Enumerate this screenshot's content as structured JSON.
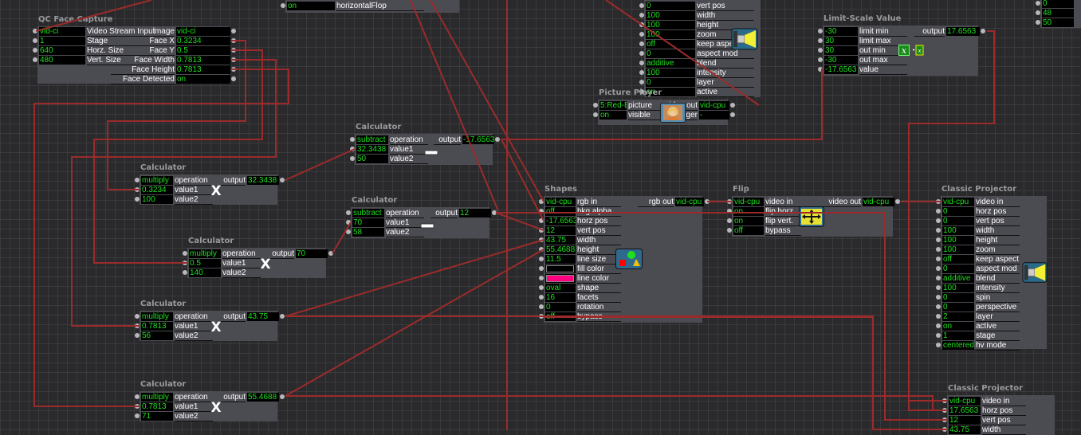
{
  "colors": {
    "wire": "#9b2b2b",
    "value_text": "#1ee11e",
    "node_body": "#4b4b52",
    "node_title": "#9a9a9e"
  },
  "nodes": [
    {
      "title": "",
      "inputs": [
        {
          "value": "on",
          "label": "horizontalFlop"
        }
      ],
      "outputs": [],
      "icon": ""
    },
    {
      "title": "QC Face Capture",
      "inputs": [
        {
          "value": "vid-ci",
          "label": "Video Stream Input"
        },
        {
          "value": "1",
          "label": "Stage"
        },
        {
          "value": "640",
          "label": "Horz. Size"
        },
        {
          "value": "480",
          "label": "Vert. Size"
        }
      ],
      "outputs": [
        {
          "label": "image",
          "value": "vid-ci"
        },
        {
          "label": "Face X",
          "value": "0.3234"
        },
        {
          "label": "Face Y",
          "value": "0.5"
        },
        {
          "label": "Face Width",
          "value": "0.7813"
        },
        {
          "label": "Face Height",
          "value": "0.7813"
        },
        {
          "label": "Face Detected",
          "value": "on"
        }
      ],
      "icon": ""
    },
    {
      "title": "",
      "inputs": [
        {
          "value": "0",
          "label": "vert pos"
        },
        {
          "value": "100",
          "label": "width"
        },
        {
          "value": "100",
          "label": "height"
        },
        {
          "value": "100",
          "label": "zoom"
        },
        {
          "value": "off",
          "label": "keep aspect"
        },
        {
          "value": "0",
          "label": "aspect mod"
        },
        {
          "value": "additive",
          "label": "blend"
        },
        {
          "value": "100",
          "label": "intensity"
        },
        {
          "value": "0",
          "label": "layer"
        },
        {
          "value": "on",
          "label": "active"
        }
      ],
      "outputs": [],
      "icon": "projector-icon"
    },
    {
      "title": "Picture Player",
      "inputs": [
        {
          "value": "5:Red-B",
          "label": "picture"
        },
        {
          "value": "on",
          "label": "visible"
        }
      ],
      "outputs": [
        {
          "label": "video out",
          "value": "vid-cpu"
        },
        {
          "label": "trigger",
          "value": "-"
        }
      ],
      "icon": "picture-icon"
    },
    {
      "title": "Limit-Scale Value",
      "inputs": [
        {
          "value": "-30",
          "label": "limit min"
        },
        {
          "value": "30",
          "label": "limit max"
        },
        {
          "value": "30",
          "label": "out min"
        },
        {
          "value": "-30",
          "label": "out max"
        },
        {
          "value": "-17.6563",
          "label": "value"
        }
      ],
      "outputs": [
        {
          "label": "output",
          "value": "17.6563"
        }
      ],
      "icon": "formula-icon"
    },
    {
      "title": "",
      "inputs": [
        {
          "value": "0",
          "label": ""
        },
        {
          "value": "48",
          "label": ""
        },
        {
          "value": "50",
          "label": ""
        }
      ],
      "outputs": [],
      "icon": ""
    },
    {
      "title": "Calculator",
      "inputs": [
        {
          "value": "subtract",
          "label": "operation"
        },
        {
          "value": "32.3438",
          "label": "value1"
        },
        {
          "value": "50",
          "label": "value2"
        }
      ],
      "outputs": [
        {
          "label": "output",
          "value": "-17.6563"
        }
      ],
      "icon": "minus-icon"
    },
    {
      "title": "Calculator",
      "inputs": [
        {
          "value": "multiply",
          "label": "operation"
        },
        {
          "value": "0.3234",
          "label": "value1"
        },
        {
          "value": "100",
          "label": "value2"
        }
      ],
      "outputs": [
        {
          "label": "output",
          "value": "32.3438"
        }
      ],
      "icon": "multiply-icon"
    },
    {
      "title": "Calculator",
      "inputs": [
        {
          "value": "subtract",
          "label": "operation"
        },
        {
          "value": "70",
          "label": "value1"
        },
        {
          "value": "58",
          "label": "value2"
        }
      ],
      "outputs": [
        {
          "label": "output",
          "value": "12"
        }
      ],
      "icon": "minus-icon"
    },
    {
      "title": "Calculator",
      "inputs": [
        {
          "value": "multiply",
          "label": "operation"
        },
        {
          "value": "0.5",
          "label": "value1"
        },
        {
          "value": "140",
          "label": "value2"
        }
      ],
      "outputs": [
        {
          "label": "output",
          "value": "70"
        }
      ],
      "icon": "multiply-icon"
    },
    {
      "title": "Calculator",
      "inputs": [
        {
          "value": "multiply",
          "label": "operation"
        },
        {
          "value": "0.7813",
          "label": "value1"
        },
        {
          "value": "56",
          "label": "value2"
        }
      ],
      "outputs": [
        {
          "label": "output",
          "value": "43.75"
        }
      ],
      "icon": "multiply-icon"
    },
    {
      "title": "Calculator",
      "inputs": [
        {
          "value": "multiply",
          "label": "operation"
        },
        {
          "value": "0.7813",
          "label": "value1"
        },
        {
          "value": "71",
          "label": "value2"
        }
      ],
      "outputs": [
        {
          "label": "output",
          "value": "55.4688"
        }
      ],
      "icon": "multiply-icon"
    },
    {
      "title": "Shapes",
      "inputs": [
        {
          "value": "vid-cpu",
          "label": "rgb in"
        },
        {
          "value": "off",
          "label": "bkg alpha"
        },
        {
          "value": "-17.6563",
          "label": "horz pos"
        },
        {
          "value": "12",
          "label": "vert pos"
        },
        {
          "value": "43.75",
          "label": "width"
        },
        {
          "value": "55.4688",
          "label": "height"
        },
        {
          "value": "11.5",
          "label": "line size"
        },
        {
          "value": "",
          "label": "fill color",
          "swatch": "#000000"
        },
        {
          "value": "",
          "label": "line color",
          "swatch": "#ff0080"
        },
        {
          "value": "oval",
          "label": "shape"
        },
        {
          "value": "16",
          "label": "facets"
        },
        {
          "value": "0",
          "label": "rotation"
        },
        {
          "value": "off",
          "label": "bypass"
        }
      ],
      "outputs": [
        {
          "label": "rgb out",
          "value": "vid-cpu"
        }
      ],
      "icon": "shapes-icon"
    },
    {
      "title": "Flip",
      "inputs": [
        {
          "value": "vid-cpu",
          "label": "video in"
        },
        {
          "value": "on",
          "label": "flip horz."
        },
        {
          "value": "on",
          "label": "flip vert."
        },
        {
          "value": "off",
          "label": "bypass"
        }
      ],
      "outputs": [
        {
          "label": "video out",
          "value": "vid-cpu"
        }
      ],
      "icon": "flip-icon"
    },
    {
      "title": "Classic Projector",
      "inputs": [
        {
          "value": "vid-cpu",
          "label": "video in"
        },
        {
          "value": "0",
          "label": "horz pos"
        },
        {
          "value": "0",
          "label": "vert pos"
        },
        {
          "value": "100",
          "label": "width"
        },
        {
          "value": "100",
          "label": "height"
        },
        {
          "value": "100",
          "label": "zoom"
        },
        {
          "value": "off",
          "label": "keep aspect"
        },
        {
          "value": "0",
          "label": "aspect mod"
        },
        {
          "value": "additive",
          "label": "blend"
        },
        {
          "value": "100",
          "label": "intensity"
        },
        {
          "value": "0",
          "label": "spin"
        },
        {
          "value": "0",
          "label": "perspective"
        },
        {
          "value": "2",
          "label": "layer"
        },
        {
          "value": "on",
          "label": "active"
        },
        {
          "value": "1",
          "label": "stage"
        },
        {
          "value": "centered",
          "label": "hv mode"
        }
      ],
      "outputs": [],
      "icon": "projector-icon"
    },
    {
      "title": "Classic Projector",
      "inputs": [
        {
          "value": "vid-cpu",
          "label": "video in"
        },
        {
          "value": "17.6563",
          "label": "horz pos"
        },
        {
          "value": "12",
          "label": "vert pos"
        },
        {
          "value": "43.75",
          "label": "width"
        }
      ],
      "outputs": [],
      "icon": ""
    }
  ]
}
